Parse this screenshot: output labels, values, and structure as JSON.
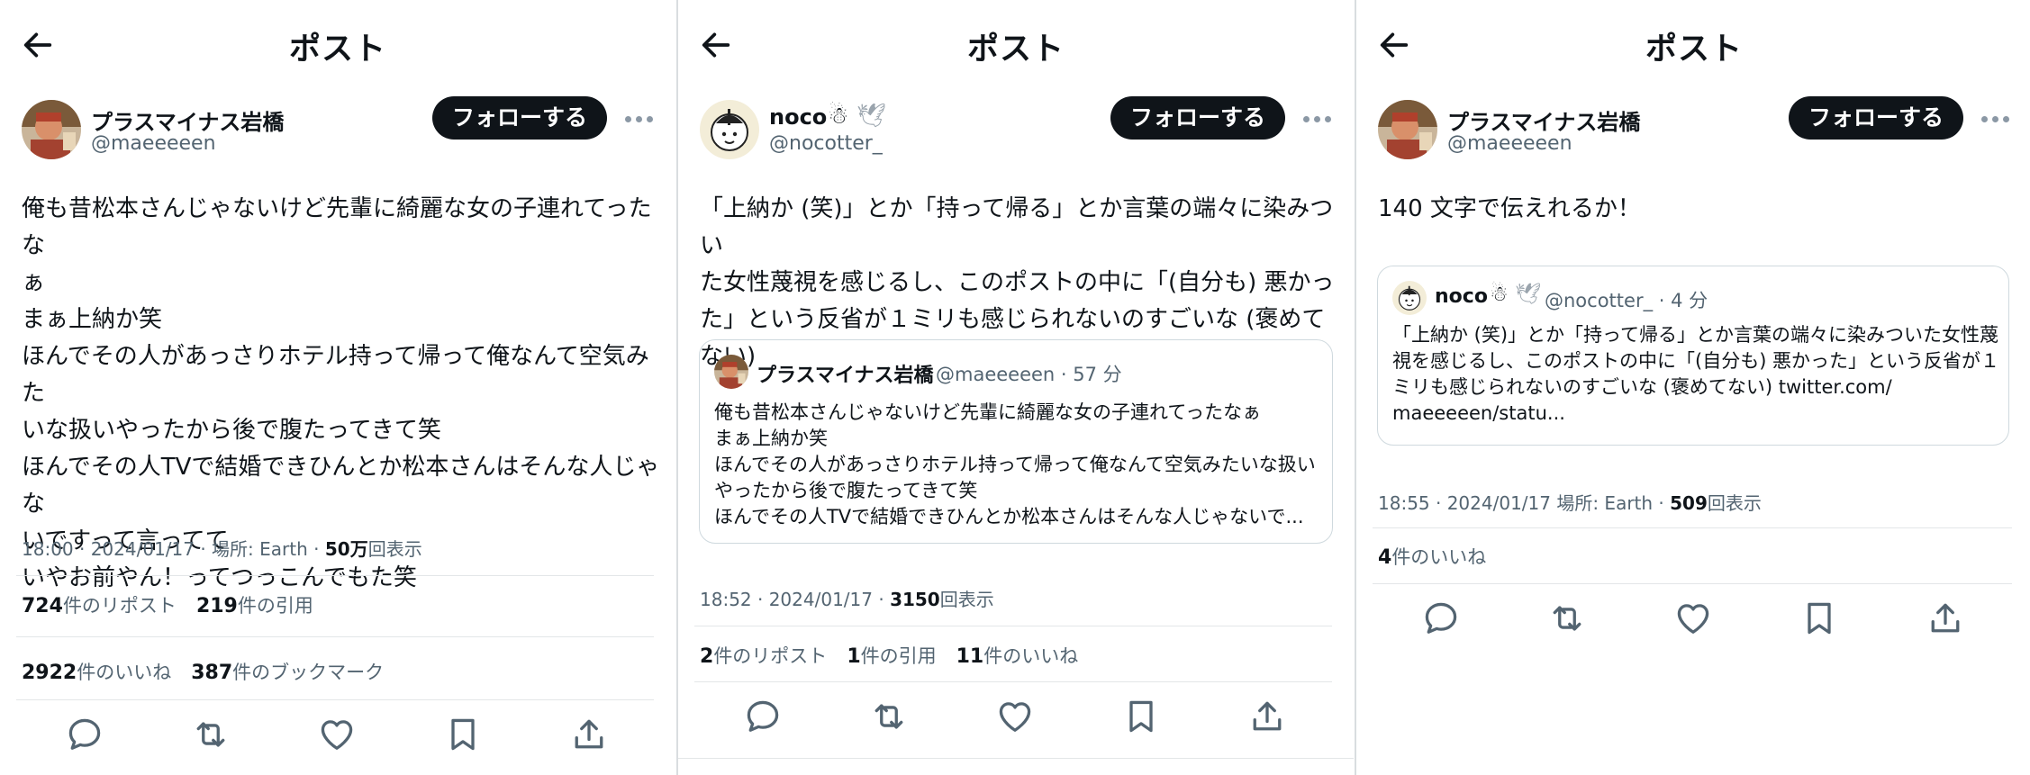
{
  "colors": {
    "text": "#0f1419",
    "muted": "#536471",
    "divider": "#e3e6e8",
    "button_bg": "#0f1419",
    "button_text": "#ffffff",
    "icon": "#536471"
  },
  "icons": [
    "back-arrow-icon",
    "more-dots-icon",
    "reply-icon",
    "retweet-icon",
    "like-icon",
    "bookmark-icon",
    "share-icon",
    "snowman-emoji-icon",
    "dove-emoji-icon"
  ],
  "panels": [
    {
      "header_title": "ポスト",
      "author": {
        "name": "プラスマイナス岩橋",
        "handle": "@maeeeeen"
      },
      "follow_label": "フォローする",
      "text": "俺も昔松本さんじゃないけど先輩に綺麗な女の子連れてったな\nぁ\nまぁ上納か笑\nほんでその人があっさりホテル持って帰って俺なんて空気みた\nいな扱いやったから後で腹たってきて笑\nほんでその人TVで結婚できひんとか松本さんはそんな人じゃな\nいですって言ってて\nいやお前やん！ってつっこんでもた笑",
      "meta": {
        "time": "18:00 · 2024/01/17 · 場所: Earth · ",
        "views_num": "50万",
        "views_label": "回表示"
      },
      "stats_row1": [
        {
          "num": "724",
          "label": "件のリポスト"
        },
        {
          "num": "219",
          "label": "件の引用"
        }
      ],
      "stats_row2": [
        {
          "num": "2922",
          "label": "件のいいね"
        },
        {
          "num": "387",
          "label": "件のブックマーク"
        }
      ]
    },
    {
      "header_title": "ポスト",
      "author": {
        "name": "noco",
        "handle": "@nocotter_"
      },
      "follow_label": "フォローする",
      "text": "「上納か (笑)」とか「持って帰る」とか言葉の端々に染みつい\nた女性蔑視を感じるし、このポストの中に「(自分も) 悪かっ\nた」という反省が１ミリも感じられないのすごいな (褒めてない)",
      "quote": {
        "name": "プラスマイナス岩橋",
        "handle": "@maeeeeen · 57 分",
        "text": "俺も昔松本さんじゃないけど先輩に綺麗な女の子連れてったなぁ\nまぁ上納か笑\nほんでその人があっさりホテル持って帰って俺なんて空気みたいな扱い\nやったから後で腹たってきて笑\nほんでその人TVで結婚できひんとか松本さんはそんな人じゃないで..."
      },
      "meta": {
        "time": "18:52 · 2024/01/17 · ",
        "views_num": "3150",
        "views_label": "回表示"
      },
      "stats_row1": [
        {
          "num": "2",
          "label": "件のリポスト"
        },
        {
          "num": "1",
          "label": "件の引用"
        },
        {
          "num": "11",
          "label": "件のいいね"
        }
      ]
    },
    {
      "header_title": "ポスト",
      "author": {
        "name": "プラスマイナス岩橋",
        "handle": "@maeeeeen"
      },
      "follow_label": "フォローする",
      "text": "140 文字で伝えれるか！",
      "quote": {
        "name": "noco",
        "handle": "@nocotter_ · 4 分",
        "text": "「上納か (笑)」とか「持って帰る」とか言葉の端々に染みついた女性蔑\n視を感じるし、このポストの中に「(自分も) 悪かった」という反省が１\nミリも感じられないのすごいな (褒めてない) twitter.com/\nmaeeeeen/statu..."
      },
      "meta": {
        "time": "18:55 · 2024/01/17 場所: Earth · ",
        "views_num": "509",
        "views_label": "回表示"
      },
      "stats_row1": [
        {
          "num": "4",
          "label": "件のいいね"
        }
      ]
    }
  ]
}
